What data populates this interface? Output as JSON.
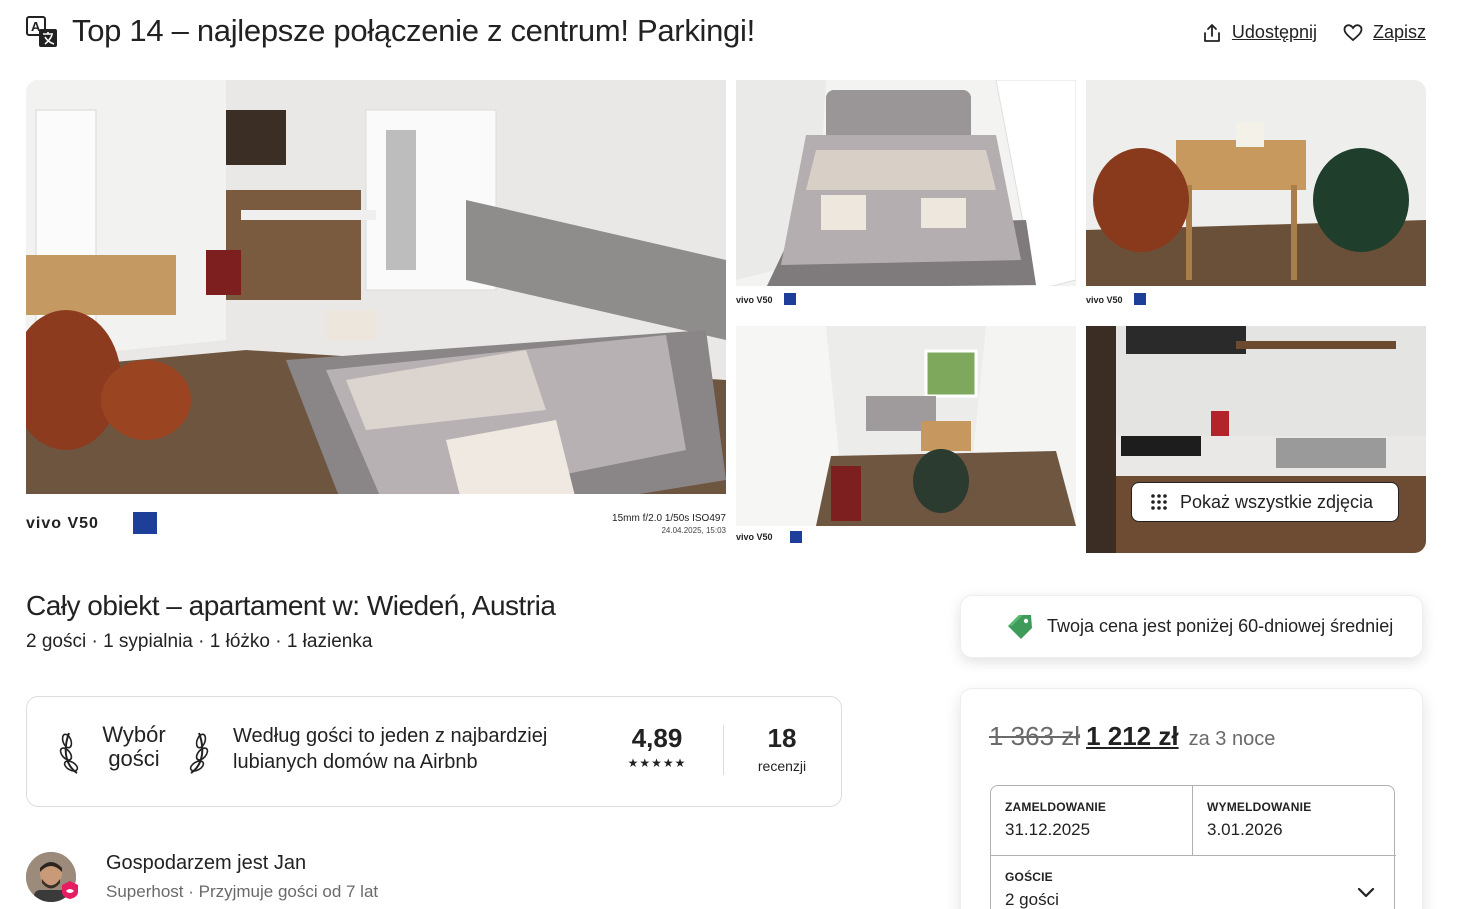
{
  "header": {
    "title": "Top 14 – najlepsze połączenie z centrum! Parkingi!",
    "share_label": "Udostępnij",
    "save_label": "Zapisz",
    "icons": [
      "translate-icon",
      "share-icon",
      "heart-icon"
    ]
  },
  "gallery": {
    "show_all_label": "Pokaż wszystkie zdjęcia",
    "photo_stamps": {
      "main_brand": "vivo V50",
      "main_exif": "15mm  f/2.0  1/50s  ISO497",
      "main_date": "24.04.2025, 15:03",
      "small_brand": "vivo V50"
    }
  },
  "listing": {
    "title": "Cały obiekt – apartament w: Wiedeń, Austria",
    "details": "2 gości · 1 sypialnia · 1 łóżko · 1 łazienka"
  },
  "guest_favorite": {
    "label": "Wybór gości",
    "description": "Według gości to jeden z najbardziej lubianych domów na Airbnb",
    "rating": "4,89",
    "stars": "★★★★★",
    "reviews_count": "18",
    "reviews_label": "recenzji"
  },
  "host": {
    "name": "Gospodarzem jest Jan",
    "subtitle": "Superhost · Przyjmuje gości od 7 lat"
  },
  "price_note": {
    "text": "Twoja cena jest poniżej 60-dniowej średniej"
  },
  "booking": {
    "old_price": "1 363 zł",
    "new_price": "1 212 zł",
    "nights": "za 3 noce",
    "checkin_label": "ZAMELDOWANIE",
    "checkin_value": "31.12.2025",
    "checkout_label": "WYMELDOWANIE",
    "checkout_value": "3.01.2026",
    "guests_label": "GOŚCIE",
    "guests_value": "2 gości"
  },
  "colors": {
    "text": "#222222",
    "muted": "#6a6a6a",
    "border": "#dddddd",
    "tag_green": "#3f9b5a"
  }
}
